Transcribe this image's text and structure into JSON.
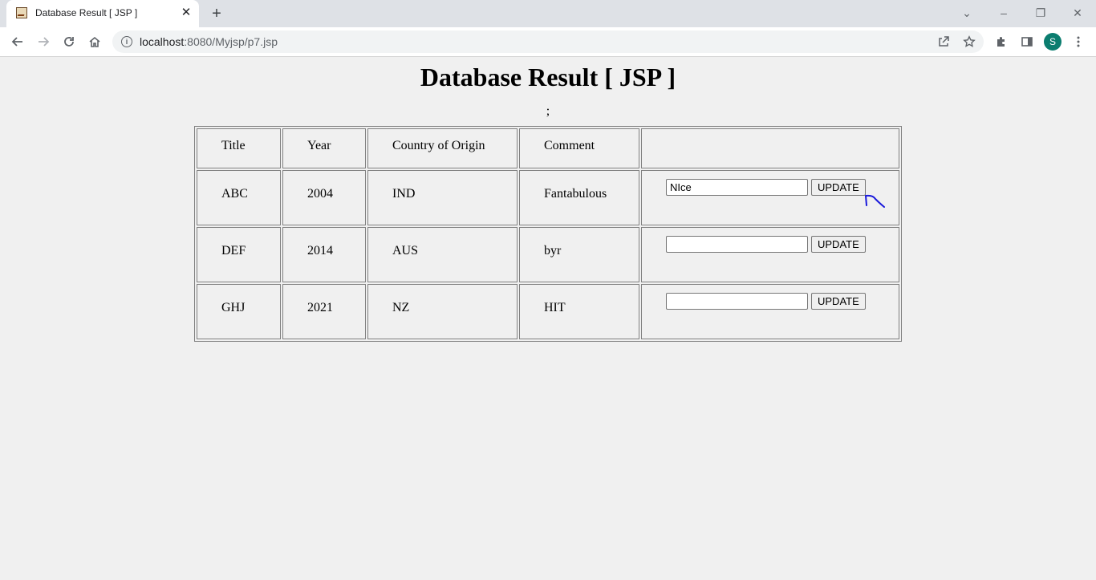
{
  "browser": {
    "tab_title": "Database Result [ JSP ]",
    "url_host": "localhost",
    "url_rest": ":8080/Myjsp/p7.jsp",
    "profile_initial": "S",
    "icons": [
      "back-icon",
      "forward-icon",
      "reload-icon",
      "home-icon",
      "info-icon",
      "share-icon",
      "star-icon",
      "extensions-icon",
      "sidepanel-icon",
      "menu-icon"
    ]
  },
  "page": {
    "title": "Database Result [ JSP ]",
    "stray_text": ";"
  },
  "table": {
    "headers": [
      "Title",
      "Year",
      "Country of Origin",
      "Comment"
    ],
    "rows": [
      {
        "title": "ABC",
        "year": "2004",
        "country": "IND",
        "comment": "Fantabulous",
        "input_value": "NIce",
        "button": "UPDATE"
      },
      {
        "title": "DEF",
        "year": "2014",
        "country": "AUS",
        "comment": "byr",
        "input_value": "",
        "button": "UPDATE"
      },
      {
        "title": "GHJ",
        "year": "2021",
        "country": "NZ",
        "comment": "HIT",
        "input_value": "",
        "button": "UPDATE"
      }
    ]
  },
  "colors": {
    "annotation": "#1a1adb",
    "avatar": "#0b7d6f"
  }
}
